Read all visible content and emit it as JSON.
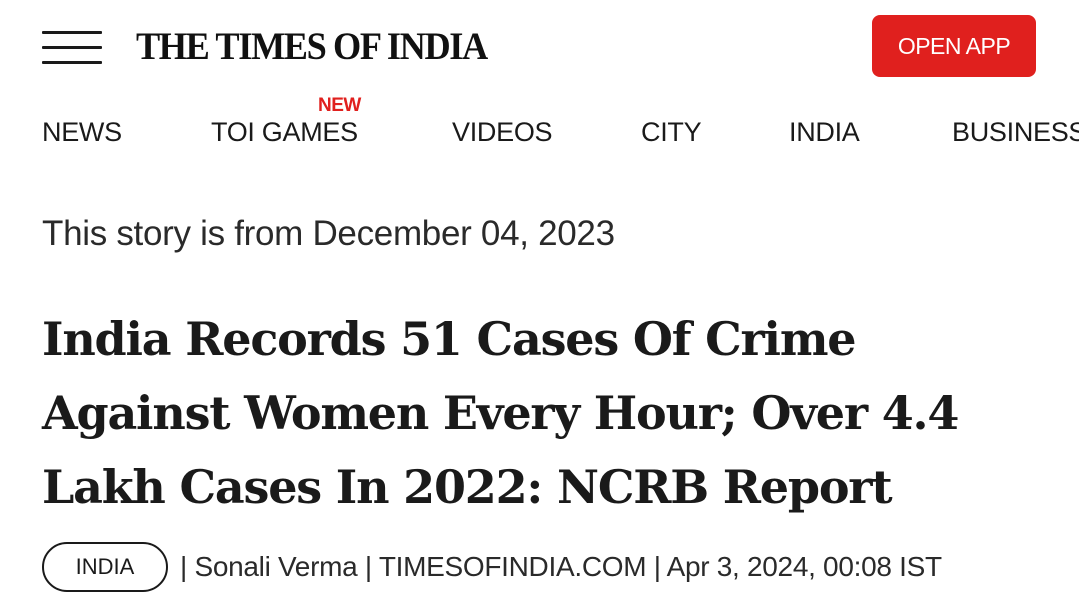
{
  "header": {
    "menu_icon": "hamburger-menu-icon",
    "logo_text": "THE TIMES OF INDIA",
    "open_app_label": "OPEN APP",
    "accent_color": "#e0201e"
  },
  "nav": {
    "items": [
      {
        "label": "NEWS"
      },
      {
        "label": "TOI GAMES",
        "badge": "NEW"
      },
      {
        "label": "VIDEOS"
      },
      {
        "label": "CITY"
      },
      {
        "label": "INDIA"
      },
      {
        "label": "BUSINESS"
      }
    ]
  },
  "article": {
    "story_date": "This story is from December 04, 2023",
    "headline_lines": [
      "India Records 51 Cases Of Crime",
      "Against Women Every Hour; Over 4.4",
      "Lakh Cases In 2022: NCRB Report"
    ],
    "meta": {
      "category": "INDIA",
      "byline": "| Sonali Verma | TIMESOFINDIA.COM | Apr 3, 2024, 00:08 IST"
    }
  }
}
